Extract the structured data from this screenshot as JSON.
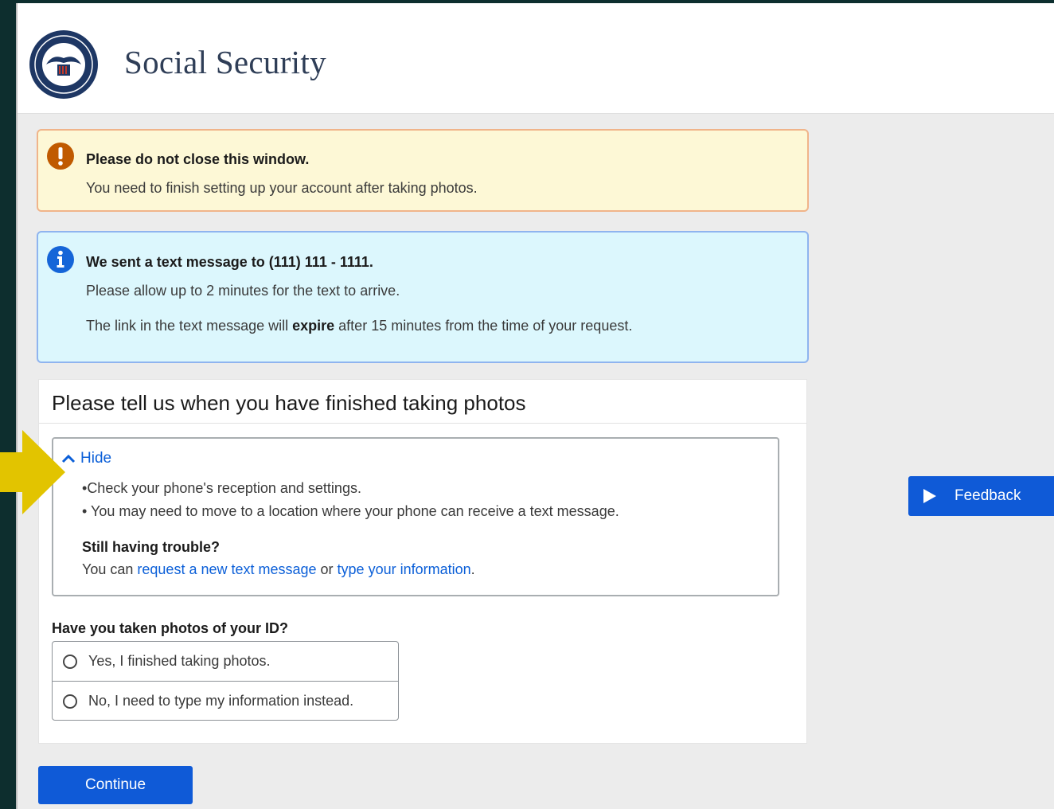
{
  "header": {
    "title": "Social Security",
    "seal_text": "SOCIAL SECURITY ADMINISTRATION",
    "seal_center": "USA"
  },
  "alerts": {
    "warning": {
      "icon": "exclamation-icon",
      "title": "Please do not close this window.",
      "text": "You need to finish setting up your account after taking photos."
    },
    "info": {
      "icon": "info-icon",
      "title": "We sent a text message to (111) 111 - 1111.",
      "text1": "Please allow up to 2 minutes for the text to arrive.",
      "text2_prefix": "The link in the text message will ",
      "text2_bold": "expire",
      "text2_suffix": " after 15 minutes from the time of your request."
    }
  },
  "card": {
    "title": "Please tell us when you have finished taking photos",
    "accordion": {
      "toggle_label": "Hide",
      "bullets": [
        "Check your phone's reception and settings.",
        "You may need to move to a location where your phone can receive a text message."
      ],
      "trouble_title": "Still having trouble?",
      "trouble_prefix": "You can ",
      "link_request": "request a new text message",
      "trouble_middle": " or ",
      "link_type": "type your information",
      "trouble_suffix": "."
    },
    "question": "Have you taken photos of your ID?",
    "options": [
      "Yes, I finished taking photos.",
      "No, I need to type my information instead."
    ]
  },
  "buttons": {
    "continue": "Continue",
    "feedback": "Feedback"
  },
  "colors": {
    "primary": "#0f5ad7",
    "link": "#0b5fd8",
    "warning_bg": "#fdf8d6",
    "warning_border": "#f0b48a",
    "warning_icon": "#c05a00",
    "info_bg": "#dcf7fd",
    "info_border": "#8fb4ef",
    "info_icon": "#1565d8",
    "annotation_arrow": "#e2c400"
  }
}
